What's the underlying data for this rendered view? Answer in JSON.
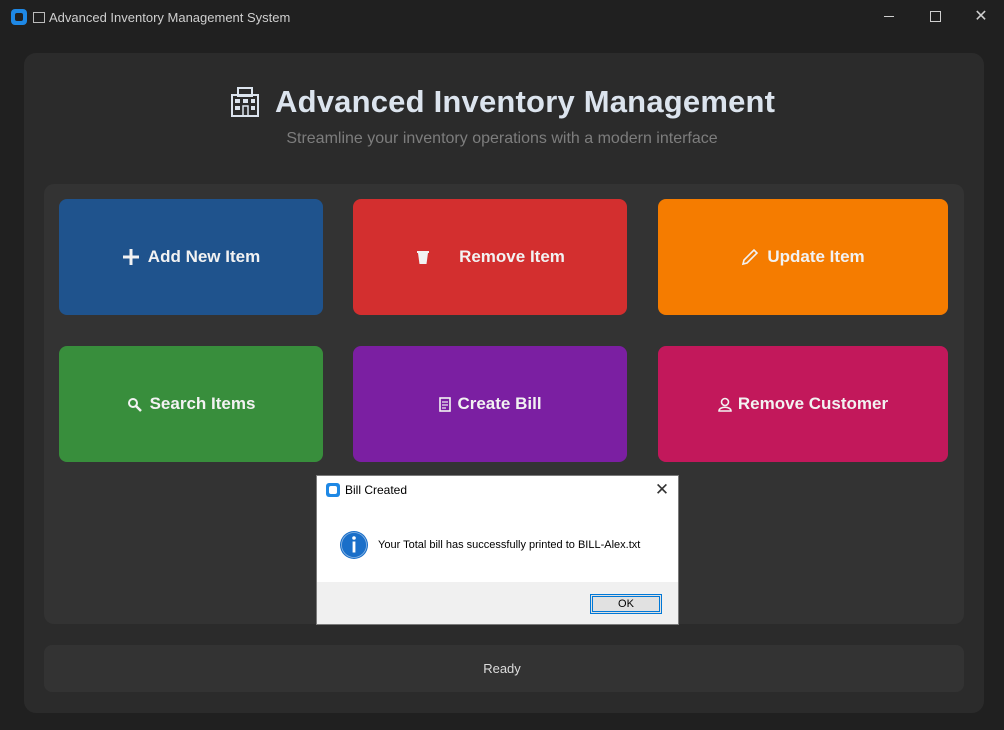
{
  "window": {
    "title": "Advanced Inventory Management System",
    "minimize_icon": "minimize-icon",
    "maximize_icon": "maximize-icon",
    "close_glyph": "✕"
  },
  "header": {
    "icon": "store-icon",
    "title": "Advanced Inventory Management",
    "subtitle": "Streamline your inventory operations with a modern interface"
  },
  "buttons": [
    {
      "label": "Add New Item",
      "icon": "plus-icon",
      "color": "#1f538d"
    },
    {
      "label": "Remove Item",
      "icon": "trash-icon",
      "color": "#d32f2f"
    },
    {
      "label": "Update Item",
      "icon": "pencil-icon",
      "color": "#f57c00"
    },
    {
      "label": "Search Items",
      "icon": "magnifier-icon",
      "color": "#388e3c"
    },
    {
      "label": "Create Bill",
      "icon": "receipt-icon",
      "color": "#7b1fa2"
    },
    {
      "label": "Remove Customer",
      "icon": "person-icon",
      "color": "#c2185b"
    }
  ],
  "status": {
    "text": "Ready"
  },
  "dialog": {
    "title": "Bill Created",
    "icon": "info-icon",
    "message": "Your Total bill has successfully printed to BILL-Alex.txt",
    "ok_label": "OK",
    "close_glyph": "✕"
  },
  "colors": {
    "background": "#202020",
    "panel": "#2b2b2b",
    "button_area": "#333333",
    "title_text": "#dce4ee",
    "subtitle_text": "#7d7d7d",
    "dialog_accent": "#0078d7"
  }
}
